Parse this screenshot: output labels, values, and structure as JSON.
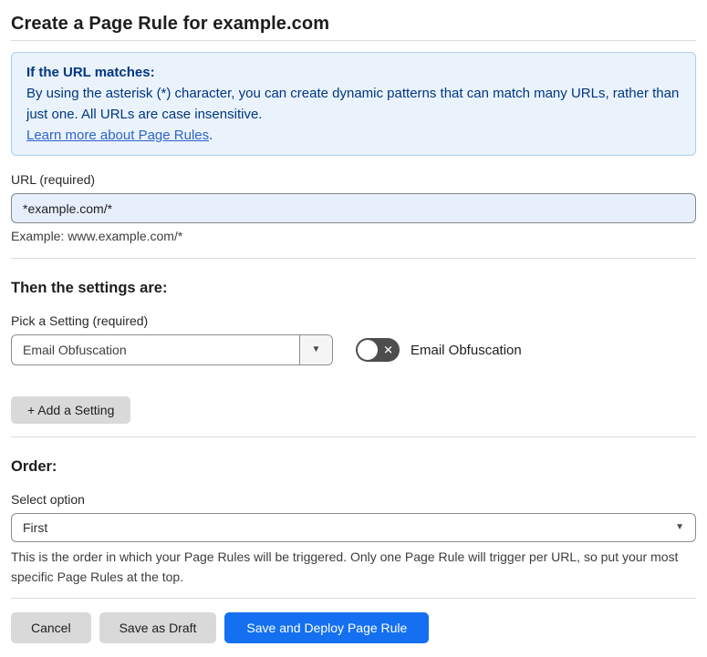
{
  "page": {
    "title": "Create a Page Rule for example.com"
  },
  "info_box": {
    "heading": "If the URL matches:",
    "body": "By using the asterisk (*) character, you can create dynamic patterns that can match many URLs, rather than just one. All URLs are case insensitive.",
    "link_label": "Learn more about Page Rules",
    "link_suffix": "."
  },
  "url_field": {
    "label": "URL (required)",
    "value": "*example.com/*",
    "helper": "Example: www.example.com/*"
  },
  "settings_section": {
    "heading": "Then the settings are:",
    "picker_label": "Pick a Setting (required)",
    "picker_value": "Email Obfuscation",
    "toggle_label": "Email Obfuscation",
    "toggle_state": "off",
    "add_button_label": "+ Add a Setting"
  },
  "order_section": {
    "heading": "Order:",
    "select_label": "Select option",
    "select_value": "First",
    "helper": "This is the order in which your Page Rules will be triggered. Only one Page Rule will trigger per URL, so put your most specific Page Rules at the top."
  },
  "footer": {
    "cancel_label": "Cancel",
    "save_draft_label": "Save as Draft",
    "save_deploy_label": "Save and Deploy Page Rule"
  },
  "icons": {
    "dropdown_caret": "▼",
    "toggle_off_x": "✕"
  },
  "colors": {
    "accent_blue": "#1470f0",
    "info_bg": "#eaf3fc",
    "info_border": "#abcdee",
    "info_text": "#003682",
    "link_blue": "#2e63cb",
    "input_bg": "#e8effc",
    "gray_button": "#d9d9d9",
    "toggle_bg": "#4d4d4d"
  }
}
